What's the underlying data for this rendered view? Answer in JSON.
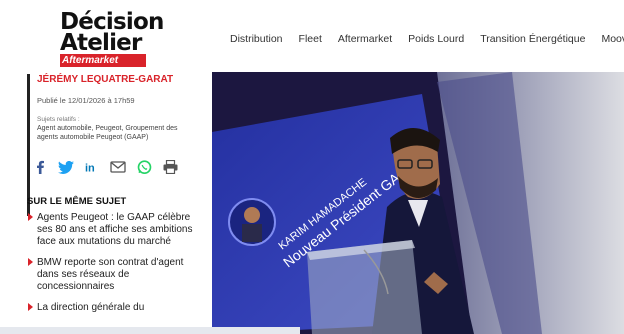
{
  "header": {
    "logo": {
      "line1": "Décision",
      "line2": "Atelier",
      "tag": "Aftermarket"
    },
    "nav": [
      "Distribution",
      "Fleet",
      "Aftermarket",
      "Poids Lourd",
      "Transition Énergétique",
      "Moov"
    ]
  },
  "article": {
    "author": "JÉRÉMY LEQUATRE-GARAT",
    "published": "Publié le 12/01/2026 à 17h59",
    "subjects_label": "Sujets relatifs :",
    "subjects": "Agent automobile, Peugeot, Groupement des agents automobile Peugeot (GAAP)",
    "share_icons": [
      "facebook-icon",
      "twitter-icon",
      "linkedin-icon",
      "email-icon",
      "whatsapp-icon",
      "print-icon"
    ]
  },
  "related": {
    "title": "SUR LE MÊME SUJET",
    "items": [
      "Agents Peugeot : le GAAP célèbre ses 80 ans et affiche ses ambitions face aux mutations du marché",
      "BMW reporte son contrat d'agent dans ses réseaux de concessionnaires",
      "La direction générale du"
    ]
  },
  "hero": {
    "screen_name": "KARIM HAMADACHE",
    "screen_title": "Nouveau Président GAAP"
  },
  "colors": {
    "accent": "#d9232a",
    "screen_blue": "#2d3aa8"
  }
}
